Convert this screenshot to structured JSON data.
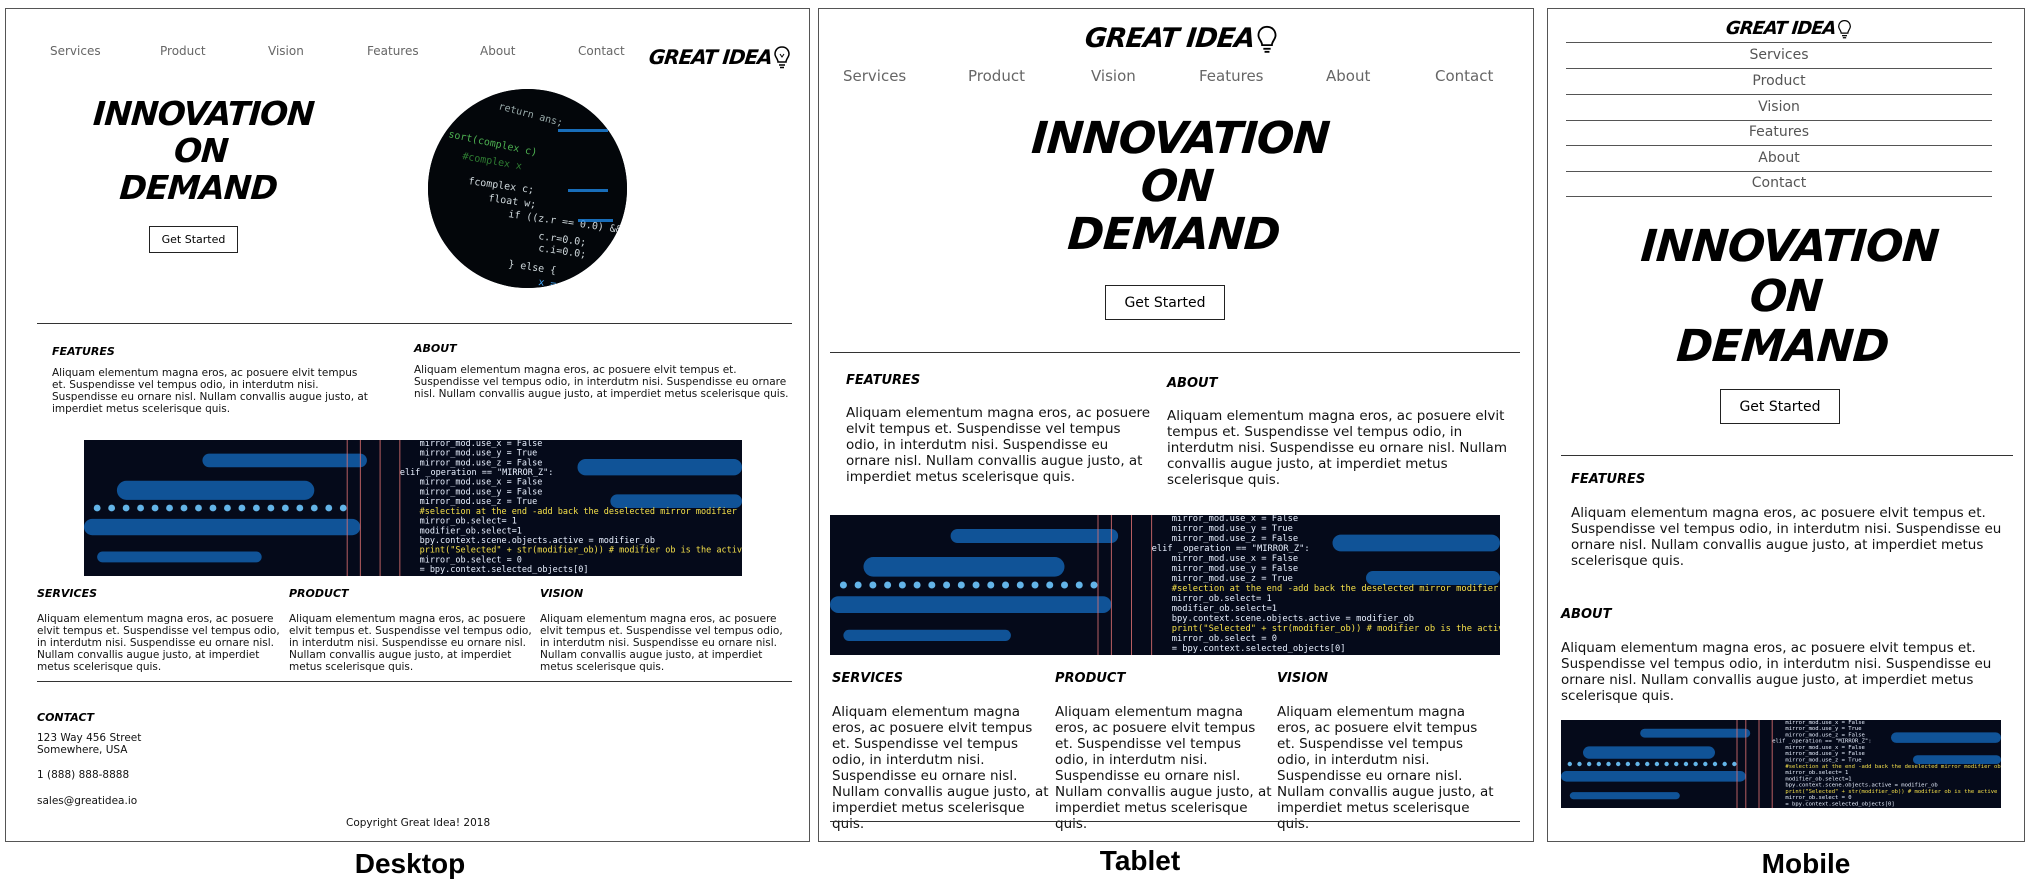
{
  "labels": {
    "desktop": "Desktop",
    "tablet": "Tablet",
    "mobile": "Mobile"
  },
  "brand": {
    "name": "GREAT IDEA"
  },
  "nav": [
    "Services",
    "Product",
    "Vision",
    "Features",
    "About",
    "Contact"
  ],
  "hero": {
    "line1": "INNOVATION",
    "line2": "ON",
    "line3": "DEMAND",
    "cta": "Get Started"
  },
  "sections": {
    "features": {
      "title": "FEATURES",
      "body": "Aliquam elementum magna eros, ac posuere elvit tempus et. Suspendisse vel tempus odio, in interdutm nisi. Suspendisse eu ornare nisl. Nullam convallis augue justo, at imperdiet metus scelerisque quis."
    },
    "about": {
      "title": "ABOUT",
      "body": "Aliquam elementum magna eros, ac posuere elvit tempus et. Suspendisse vel tempus odio, in interdutm nisi. Suspendisse eu ornare nisl. Nullam convallis augue justo, at imperdiet metus scelerisque quis."
    },
    "services": {
      "title": "SERVICES",
      "body": "Aliquam elementum magna eros, ac posuere elvit tempus et. Suspendisse vel tempus odio, in interdutm nisi. Suspendisse eu ornare nisl. Nullam convallis augue justo, at imperdiet metus scelerisque quis."
    },
    "product": {
      "title": "PRODUCT",
      "body": "Aliquam elementum magna eros, ac posuere elvit tempus et. Suspendisse vel tempus odio, in interdutm nisi. Suspendisse eu ornare nisl. Nullam convallis augue justo, at imperdiet metus scelerisque quis."
    },
    "vision": {
      "title": "VISION",
      "body": "Aliquam elementum magna eros, ac posuere elvit tempus et. Suspendisse vel tempus odio, in interdutm nisi. Suspendisse eu ornare nisl. Nullam convallis augue justo, at imperdiet metus scelerisque quis."
    }
  },
  "contact": {
    "title": "CONTACT",
    "address1": "123 Way 456 Street",
    "address2": "Somewhere, USA",
    "phone": "1 (888) 888-8888",
    "email": "sales@greatidea.io"
  },
  "copyright": "Copyright Great Idea! 2018",
  "code_lines": [
    "mirror_mod.use_x = False",
    "mirror_mod.use_y = True",
    "mirror_mod.use_z = False",
    "elif _operation == \"MIRROR_Z\":",
    "mirror_mod.use_x = False",
    "mirror_mod.use_y = False",
    "mirror_mod.use_z = True",
    "#selection at the end -add back the deselected mirror modifier object",
    "mirror_ob.select= 1",
    "modifier_ob.select=1",
    "bpy.context.scene.objects.active = modifier_ob",
    "print(\"Selected\" + str(modifier_ob)) # modifier ob is the active ob",
    "mirror_ob.select = 0",
    "= bpy.context.selected_objects[0]"
  ],
  "colors": {
    "border": "#555555",
    "nav_text": "#666666",
    "code_bg": "#050a1a",
    "code_blue": "#1a8fff",
    "code_yellow": "#f5e04a"
  }
}
